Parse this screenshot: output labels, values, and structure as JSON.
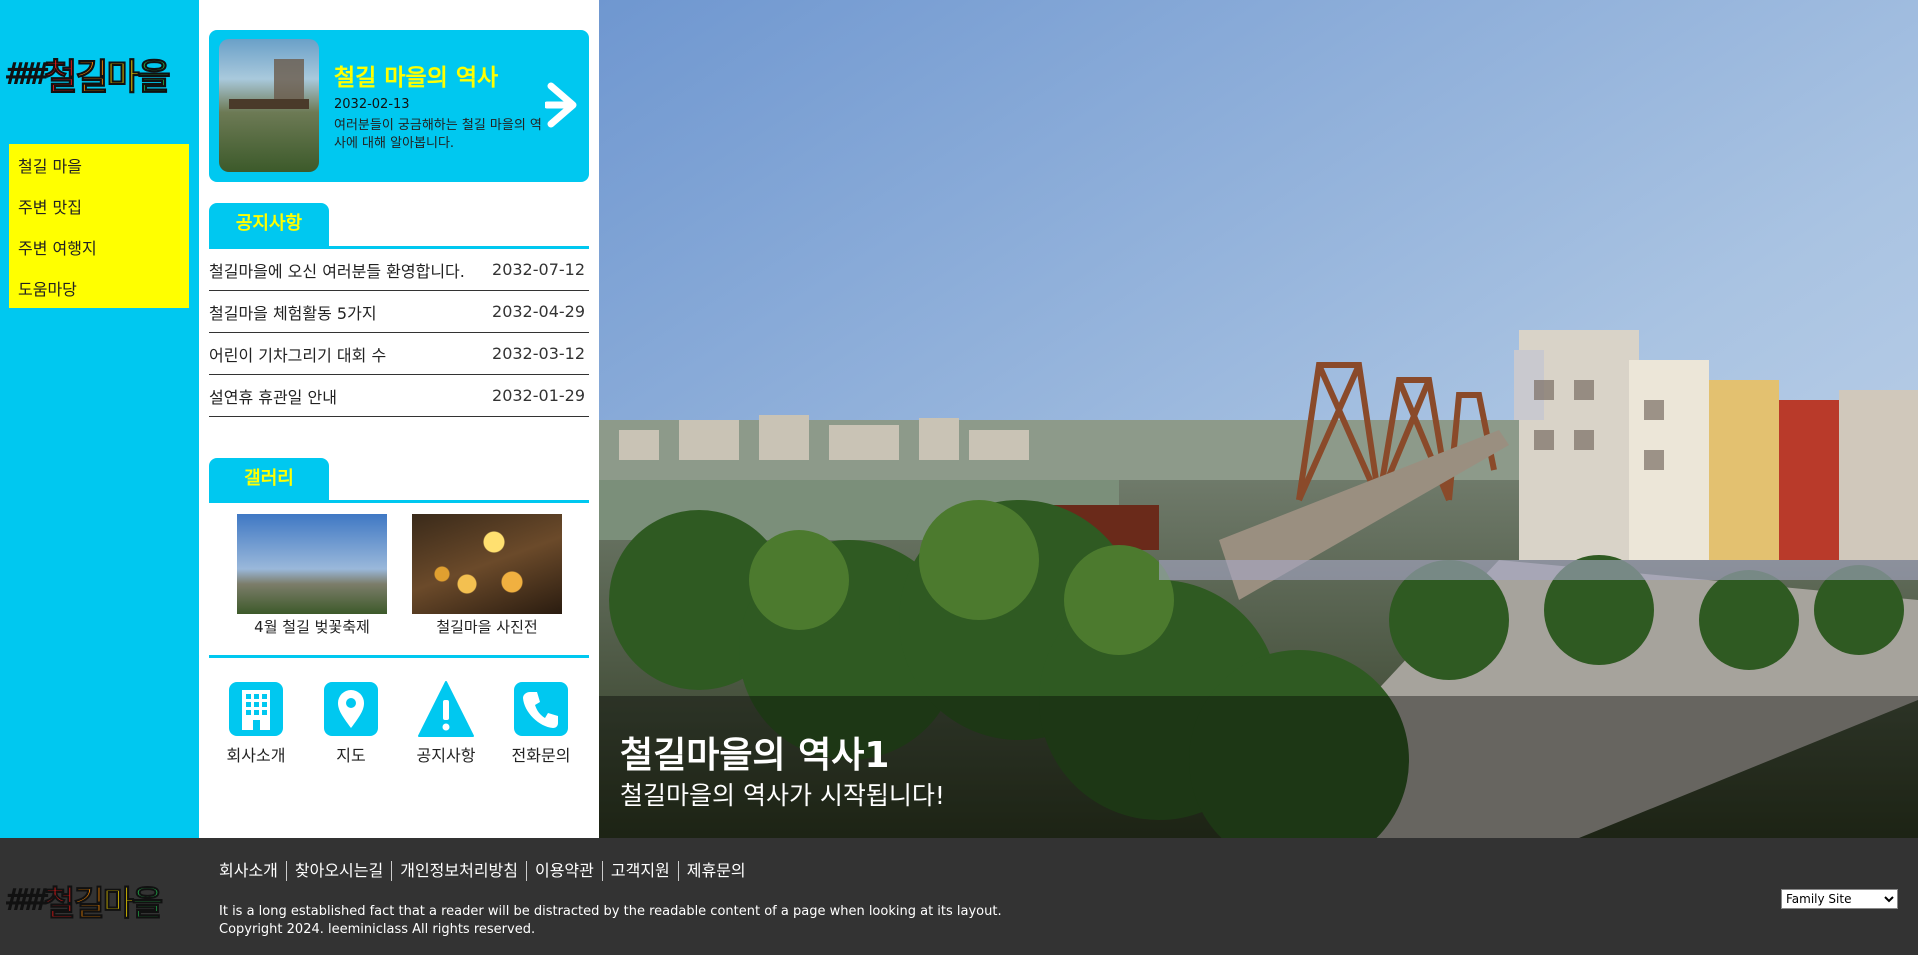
{
  "brand": {
    "rail": "###",
    "name_chars": [
      "철",
      "길",
      "마",
      "을"
    ]
  },
  "nav": {
    "items": [
      {
        "label": "철길 마을"
      },
      {
        "label": "주변 맛집"
      },
      {
        "label": "주변 여행지"
      },
      {
        "label": "도움마당"
      }
    ]
  },
  "feature": {
    "title": "철길 마을의 역사",
    "date": "2032-02-13",
    "description": "여러분들이 궁금해하는 철길 마을의 역사에 대해 알아봅니다.",
    "arrow_icon": "arrow-right-icon"
  },
  "notice": {
    "tab_label": "공지사항",
    "rows": [
      {
        "title": "철길마을에 오신 여러분들 환영합니다.",
        "date": "2032-07-12"
      },
      {
        "title": "철길마을 체험활동 5가지",
        "date": "2032-04-29"
      },
      {
        "title": "어린이 기차그리기 대회 수",
        "date": "2032-03-12"
      },
      {
        "title": "설연휴 휴관일 안내",
        "date": "2032-01-29"
      }
    ]
  },
  "gallery": {
    "tab_label": "갤러리",
    "items": [
      {
        "caption": "4월 철길 벚꽃축제"
      },
      {
        "caption": "철길마을 사진전"
      }
    ]
  },
  "quick_links": [
    {
      "label": "회사소개",
      "icon": "building-icon"
    },
    {
      "label": "지도",
      "icon": "map-pin-icon"
    },
    {
      "label": "공지사항",
      "icon": "warning-icon"
    },
    {
      "label": "전화문의",
      "icon": "phone-icon"
    }
  ],
  "hero": {
    "title": "철길마을의 역사1",
    "subtitle": "철길마을의 역사가 시작됩니다!"
  },
  "footer": {
    "links": [
      "회사소개",
      "찾아오시는길",
      "개인정보처리방침",
      "이용약관",
      "고객지원",
      "제휴문의"
    ],
    "description": "It is a long established fact that a reader will be distracted by the readable content of a page when looking at its layout.",
    "copyright": "Copyright 2024. leeminiclass All rights reserved.",
    "family_site": "Family Site"
  },
  "colors": {
    "accent": "#00c8f0",
    "highlight": "#ffff00",
    "footer_bg": "#333333"
  }
}
